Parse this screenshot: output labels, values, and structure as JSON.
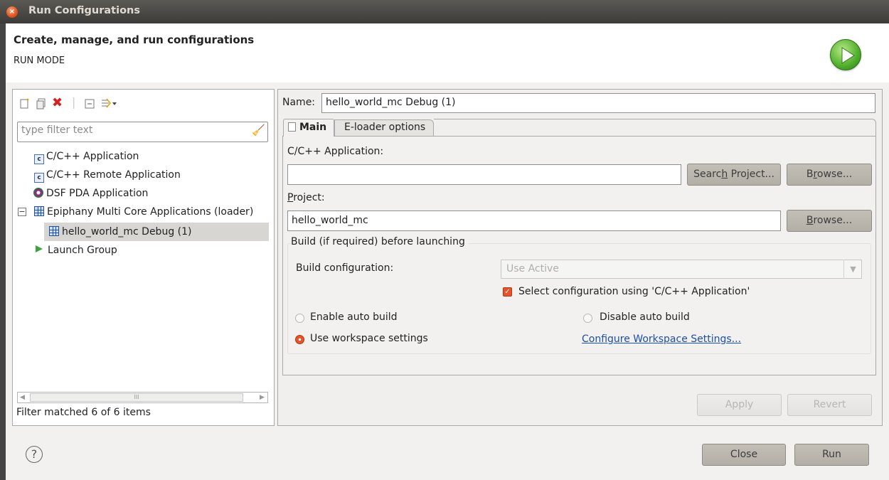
{
  "window": {
    "title": "Run Configurations"
  },
  "header": {
    "title": "Create, manage, and run configurations",
    "subtitle": "RUN MODE"
  },
  "left_panel": {
    "filter_placeholder": "type filter text",
    "tree": [
      {
        "label": "C/C++ Application",
        "icon": "c-app-icon"
      },
      {
        "label": "C/C++ Remote Application",
        "icon": "c-app-icon"
      },
      {
        "label": "DSF PDA Application",
        "icon": "pda-icon"
      },
      {
        "label": "Epiphany Multi Core Applications (loader)",
        "icon": "grid-icon",
        "expanded": true
      },
      {
        "label": "hello_world_mc Debug (1)",
        "icon": "grid-icon",
        "selected": true
      },
      {
        "label": "Launch Group",
        "icon": "launch-icon"
      }
    ],
    "scroll_mark": "III",
    "status": "Filter matched 6 of 6 items"
  },
  "right_panel": {
    "name_label": "Name:",
    "name_value": "hello_world_mc Debug (1)",
    "tabs": [
      {
        "label": "Main",
        "active": true
      },
      {
        "label": "E-loader options",
        "active": false
      }
    ],
    "app_label": "C/C++ Application:",
    "app_value": "",
    "search_project_pre": "Searc",
    "search_project_mn": "h",
    "search_project_post": " Project...",
    "browse1_pre": "B",
    "browse1_mn": "r",
    "browse1_post": "owse...",
    "project_label_mn": "P",
    "project_label_rest": "roject:",
    "project_value": "hello_world_mc",
    "browse2_mn": "B",
    "browse2_rest": "rowse...",
    "build_group_title": "Build (if required) before launching",
    "build_config_label": "Build configuration:",
    "build_config_value": "Use Active",
    "select_config_label": "Select configuration using 'C/C++ Application'",
    "radio_enable": "Enable auto build",
    "radio_disable": "Disable auto build",
    "radio_workspace": "Use workspace settings",
    "workspace_link": "Configure Workspace Settings...",
    "apply": "Apply",
    "revert": "Revert"
  },
  "footer": {
    "close": "Close",
    "run": "Run"
  }
}
